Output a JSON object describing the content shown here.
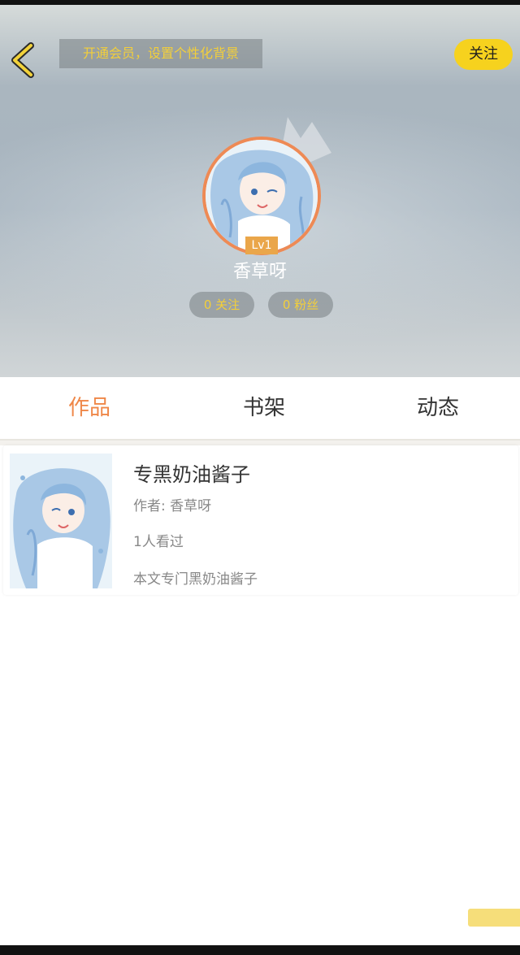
{
  "header": {
    "vip_banner": "开通会员，设置个性化背景",
    "follow_button": "关注"
  },
  "profile": {
    "level": "Lv1",
    "username": "香草呀",
    "following": "0 关注",
    "fans": "0 粉丝"
  },
  "tabs": [
    {
      "label": "作品",
      "active": true
    },
    {
      "label": "书架",
      "active": false
    },
    {
      "label": "动态",
      "active": false
    }
  ],
  "works": [
    {
      "title": "专黑奶油酱子",
      "author": "作者: 香草呀",
      "views": "1人看过",
      "description": "本文专门黑奶油酱子"
    }
  ],
  "colors": {
    "accent_orange": "#ef8748",
    "follow_yellow": "#f6d21e",
    "badge_orange": "#eaa64a",
    "pill_text": "#f3cf3a"
  },
  "icons": {
    "back": "chevron-left-icon",
    "crown": "crown-icon"
  }
}
